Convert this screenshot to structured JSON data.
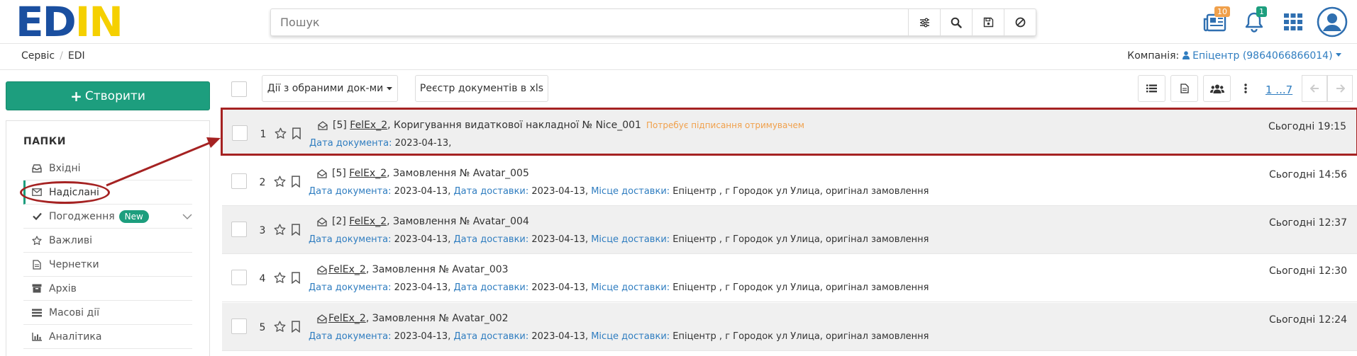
{
  "brand": {
    "logo_part1": "ED",
    "logo_part2": "IN"
  },
  "header": {
    "search_placeholder": "Пошук",
    "news_count": "10",
    "notifications_count": "1"
  },
  "breadcrumb": {
    "items": [
      "Сервіс",
      "EDI"
    ]
  },
  "company": {
    "label": "Компанія:",
    "value": "Епіцентр (9864066866014)"
  },
  "sidebar": {
    "create_label": "Створити",
    "folders_title": "ПАПКИ",
    "items": [
      {
        "label": "Вхідні",
        "icon": "inbox-icon"
      },
      {
        "label": "Надіслані",
        "icon": "envelope-icon"
      },
      {
        "label": "Погодження",
        "icon": "check-icon",
        "badge": "New"
      },
      {
        "label": "Важливі",
        "icon": "star-icon"
      },
      {
        "label": "Чернетки",
        "icon": "file-icon"
      },
      {
        "label": "Архів",
        "icon": "archive-icon"
      },
      {
        "label": "Масові дії",
        "icon": "list-icon"
      },
      {
        "label": "Аналітика",
        "icon": "bar-chart-icon"
      }
    ]
  },
  "toolbar": {
    "actions_label": "Дії з обраними док-ми",
    "export_label": "Реєстр документів в xls",
    "pager": "1 ...7"
  },
  "documents": [
    {
      "num": "1",
      "prefix": "[5]",
      "sender": "FelEx_2",
      "title": ", Коригування видаткової накладної № Nice_001",
      "warning": "Потребує підписання отримувачем",
      "date_label": "Дата документа:",
      "date": "2023-04-13,",
      "delivery_label": "",
      "delivery": "",
      "place_label": "",
      "place": "",
      "time": "Сьогодні 19:15"
    },
    {
      "num": "2",
      "prefix": "[5]",
      "sender": "FelEx_2",
      "title": ", Замовлення № Avatar_005",
      "warning": "",
      "date_label": "Дата документа:",
      "date": "2023-04-13,",
      "delivery_label": "Дата доставки:",
      "delivery": "2023-04-13,",
      "place_label": "Місце доставки:",
      "place": "Епіцентр , г Городок ул Улица, оригінал замовлення",
      "time": "Сьогодні 14:56"
    },
    {
      "num": "3",
      "prefix": "[2]",
      "sender": "FelEx_2",
      "title": ", Замовлення № Avatar_004",
      "warning": "",
      "date_label": "Дата документа:",
      "date": "2023-04-13,",
      "delivery_label": "Дата доставки:",
      "delivery": "2023-04-13,",
      "place_label": "Місце доставки:",
      "place": "Епіцентр , г Городок ул Улица, оригінал замовлення",
      "time": "Сьогодні 12:37"
    },
    {
      "num": "4",
      "prefix": "",
      "sender": "FelEx_2",
      "title": ", Замовлення № Avatar_003",
      "warning": "",
      "date_label": "Дата документа:",
      "date": "2023-04-13,",
      "delivery_label": "Дата доставки:",
      "delivery": "2023-04-13,",
      "place_label": "Місце доставки:",
      "place": "Епіцентр , г Городок ул Улица, оригінал замовлення",
      "time": "Сьогодні 12:30"
    },
    {
      "num": "5",
      "prefix": "",
      "sender": "FelEx_2",
      "title": ", Замовлення № Avatar_002",
      "warning": "",
      "date_label": "Дата документа:",
      "date": "2023-04-13,",
      "delivery_label": "Дата доставки:",
      "delivery": "2023-04-13,",
      "place_label": "Місце доставки:",
      "place": "Епіцентр , г Городок ул Улица, оригінал замовлення",
      "time": "Сьогодні 12:24"
    }
  ],
  "colors": {
    "accent": "#1d9e7e",
    "link": "#2f7dc0",
    "annotation": "#a52222",
    "warning": "#f0a04b",
    "logo_blue": "#1a4fa0",
    "logo_yellow": "#f5d000"
  }
}
